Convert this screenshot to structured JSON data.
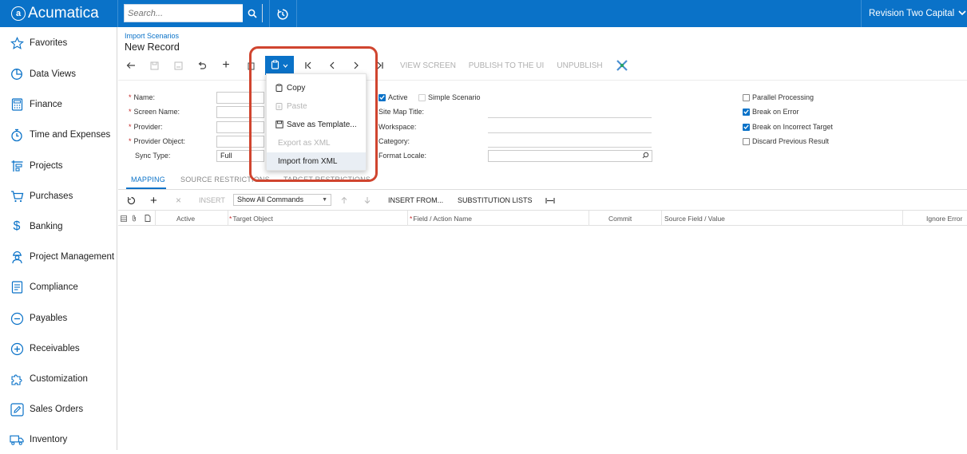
{
  "app": {
    "brand": "Acumatica",
    "company": "Revision Two Capital"
  },
  "search": {
    "placeholder": "Search..."
  },
  "sidebar": {
    "items": [
      {
        "label": "Favorites",
        "icon": "star-icon"
      },
      {
        "label": "Data Views",
        "icon": "pie-chart-icon"
      },
      {
        "label": "Finance",
        "icon": "calculator-icon"
      },
      {
        "label": "Time and Expenses",
        "icon": "stopwatch-icon"
      },
      {
        "label": "Projects",
        "icon": "projects-icon"
      },
      {
        "label": "Purchases",
        "icon": "cart-icon"
      },
      {
        "label": "Banking",
        "icon": "dollar-icon"
      },
      {
        "label": "Project Management",
        "icon": "worker-icon"
      },
      {
        "label": "Compliance",
        "icon": "document-icon"
      },
      {
        "label": "Payables",
        "icon": "minus-circle-icon"
      },
      {
        "label": "Receivables",
        "icon": "plus-circle-icon"
      },
      {
        "label": "Customization",
        "icon": "puzzle-icon"
      },
      {
        "label": "Sales Orders",
        "icon": "pencil-icon"
      },
      {
        "label": "Inventory",
        "icon": "truck-icon"
      }
    ]
  },
  "page": {
    "breadcrumb": "Import Scenarios",
    "title": "New Record"
  },
  "toolbar": {
    "view_screen": "VIEW SCREEN",
    "publish": "PUBLISH TO THE UI",
    "unpublish": "UNPUBLISH"
  },
  "form": {
    "name_label": "Name:",
    "screen_name_label": "Screen Name:",
    "provider_label": "Provider:",
    "provider_object_label": "Provider Object:",
    "sync_type_label": "Sync Type:",
    "sync_type_value": "Full",
    "active_label": "Active",
    "simple_scenario_label": "Simple Scenario",
    "site_map_title_label": "Site Map Title:",
    "workspace_label": "Workspace:",
    "category_label": "Category:",
    "format_locale_label": "Format Locale:",
    "parallel_processing_label": "Parallel Processing",
    "break_on_error_label": "Break on Error",
    "break_on_incorrect_target_label": "Break on Incorrect Target",
    "discard_previous_result_label": "Discard Previous Result",
    "active_checked": true,
    "simple_scenario_checked": false,
    "parallel_processing_checked": false,
    "break_on_error_checked": true,
    "break_on_incorrect_target_checked": true,
    "discard_previous_result_checked": false
  },
  "tabs": [
    "MAPPING",
    "SOURCE RESTRICTIONS",
    "TARGET RESTRICTIONS"
  ],
  "grid_toolbar": {
    "insert": "INSERT",
    "commands_value": "Show All Commands",
    "insert_from": "INSERT FROM...",
    "substitution_lists": "SUBSTITUTION LISTS"
  },
  "grid": {
    "columns": [
      "Active",
      "Target Object",
      "Field / Action Name",
      "Commit",
      "Source Field / Value",
      "Ignore Error"
    ]
  },
  "menu": {
    "items": [
      {
        "label": "Copy",
        "enabled": true
      },
      {
        "label": "Paste",
        "enabled": false
      },
      {
        "label": "Save as Template...",
        "enabled": true
      },
      {
        "label": "Export as XML",
        "enabled": false
      },
      {
        "label": "Import from XML",
        "enabled": true
      }
    ]
  },
  "colors": {
    "brand": "#0a72c8",
    "highlight": "#d0452f",
    "required": "#c62828"
  }
}
